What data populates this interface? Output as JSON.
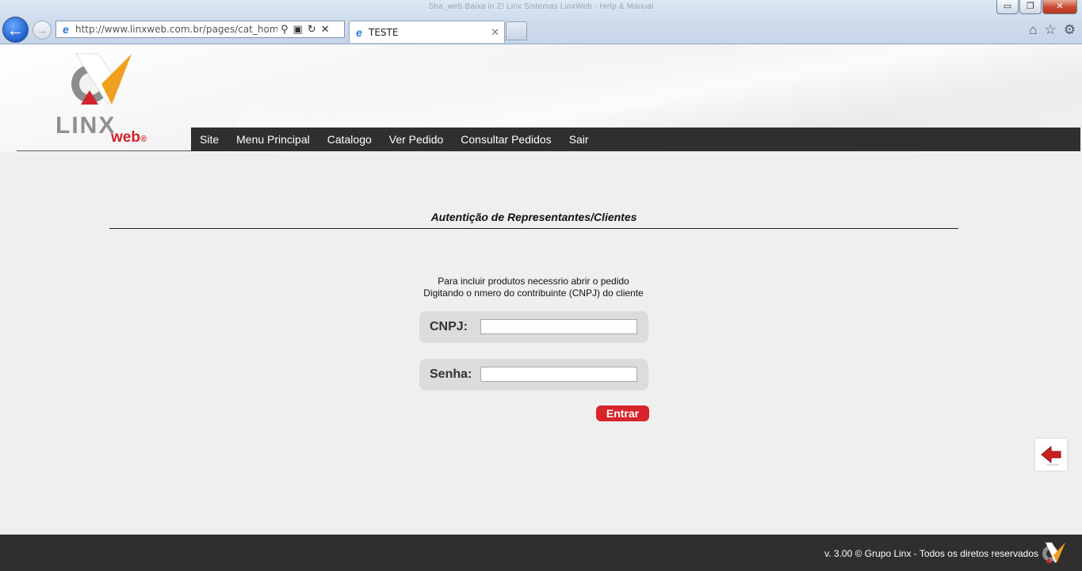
{
  "browser": {
    "window_title": "Sha_web Baixa in Z! Linx Sistemas LinxWeb - Help & Manual",
    "url": "http://www.linxweb.com.br/pages/cat_home_t.aspx",
    "tab_title": "TESTE",
    "window_controls": {
      "minimize": "▭",
      "maximize": "❐",
      "close": "✕"
    },
    "icons": [
      "back-arrow-icon",
      "forward-arrow-icon",
      "ie-icon",
      "search-icon",
      "compat-icon",
      "refresh-icon",
      "stop-icon",
      "home-icon",
      "favorites-star-icon",
      "tools-gear-icon"
    ]
  },
  "header": {
    "logo_text": "LINX",
    "logo_subtext": "web",
    "logo_mark": "®",
    "menu": [
      {
        "label": "Site"
      },
      {
        "label": "Menu Principal"
      },
      {
        "label": "Catalogo"
      },
      {
        "label": "Ver Pedido"
      },
      {
        "label": "Consultar Pedidos"
      },
      {
        "label": "Sair"
      }
    ]
  },
  "main": {
    "section_title": "Autentição de Representantes/Clientes",
    "intro_line1": "Para incluir produtos necessrio abrir o pedido",
    "intro_line2": "Digitando o nmero do contribuinte (CNPJ) do cliente",
    "cnpj": {
      "label": "CNPJ:",
      "value": ""
    },
    "senha": {
      "label": "Senha:",
      "value": ""
    },
    "submit_label": "Entrar"
  },
  "footer": {
    "text": "v. 3.00 © Grupo Linx - Todos os diretos reservados"
  },
  "colors": {
    "accent_red": "#d8232a",
    "menu_bg": "#2f2f2f",
    "logo_orange": "#f0a020",
    "logo_gray": "#8f8f8f",
    "page_bg": "#efefef"
  }
}
